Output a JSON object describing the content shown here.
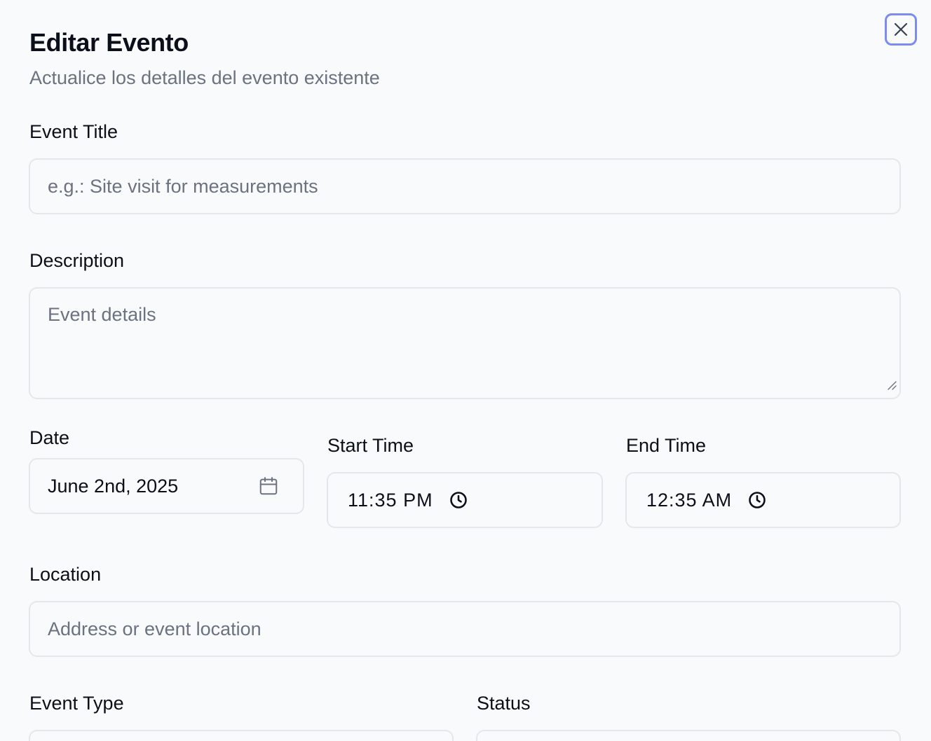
{
  "dialog": {
    "title": "Editar Evento",
    "subtitle": "Actualice los detalles del evento existente"
  },
  "form": {
    "event_title": {
      "label": "Event Title",
      "placeholder": "e.g.: Site visit for measurements",
      "value": ""
    },
    "description": {
      "label": "Description",
      "placeholder": "Event details",
      "value": ""
    },
    "date": {
      "label": "Date",
      "value": "June 2nd, 2025",
      "icon": "calendar-icon"
    },
    "start_time": {
      "label": "Start Time",
      "value": "11:35 PM",
      "icon": "clock-icon"
    },
    "end_time": {
      "label": "End Time",
      "value": "12:35 AM",
      "icon": "clock-icon"
    },
    "location": {
      "label": "Location",
      "placeholder": "Address or event location",
      "value": ""
    },
    "event_type": {
      "label": "Event Type"
    },
    "status": {
      "label": "Status"
    }
  },
  "colors": {
    "focus_ring": "#7b8cf0",
    "border": "#e5e7eb",
    "muted_text": "#6b7280",
    "background": "#f9fafb"
  }
}
